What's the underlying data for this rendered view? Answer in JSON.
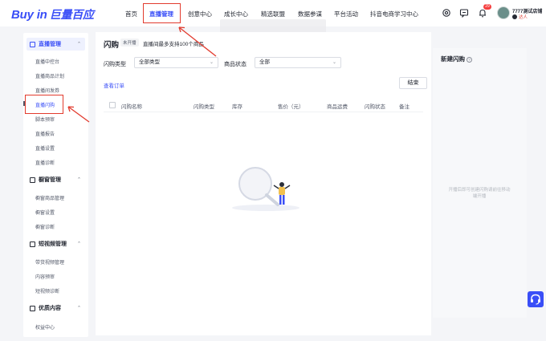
{
  "brand": {
    "logo_latin": "Buy in",
    "logo_cn": "巨量百应"
  },
  "nav": [
    {
      "label": "首页",
      "active": false
    },
    {
      "label": "直播管理",
      "active": true
    },
    {
      "label": "创意中心",
      "active": false
    },
    {
      "label": "成长中心",
      "active": false
    },
    {
      "label": "精选联盟",
      "active": false
    },
    {
      "label": "数据参谋",
      "active": false
    },
    {
      "label": "平台活动",
      "active": false
    },
    {
      "label": "抖音电商学习中心",
      "active": false
    }
  ],
  "header": {
    "notification_count": "29",
    "store_name": "7777测试店铺",
    "store_tag": "达人"
  },
  "sidebar": {
    "groups": [
      {
        "label": "直播管理",
        "expanded": true,
        "items": [
          "直播中控台",
          "直播商品计划",
          "直播间发券",
          "直播闪购",
          "脚本预审",
          "直播报告",
          "直播设置",
          "直播诊断"
        ]
      },
      {
        "label": "橱窗管理",
        "expanded": true,
        "items": [
          "橱窗商品管理",
          "橱窗设置",
          "橱窗诊断"
        ]
      },
      {
        "label": "短视频管理",
        "expanded": true,
        "items": [
          "带货视频管理",
          "内容预审",
          "短视频诊断"
        ]
      },
      {
        "label": "优质内容",
        "expanded": true,
        "items": [
          "权益中心"
        ]
      }
    ],
    "active_item": "直播闪购"
  },
  "main": {
    "title": "闪购",
    "status": "未开播",
    "limit_text": "直播间最多支持100个商品",
    "filters": {
      "type_label": "闪购类型",
      "type_value": "全部类型",
      "status_label": "商品状态",
      "status_value": "全部"
    },
    "view_orders": "查看订单",
    "end_button": "结束",
    "columns": [
      "闪购名称",
      "闪购类型",
      "库存",
      "售价（元）",
      "商品运费",
      "闪购状态",
      "备注"
    ]
  },
  "right_panel": {
    "title": "新建闪购",
    "hint": "开播后即可创建闪购请前往移动端开播"
  },
  "colors": {
    "accent": "#3a4ff7",
    "highlight": "#e23b2e",
    "badge": "#f53f3f"
  },
  "icons": [
    "settings-icon",
    "message-icon",
    "bell-icon",
    "help-icon",
    "headset-icon"
  ]
}
